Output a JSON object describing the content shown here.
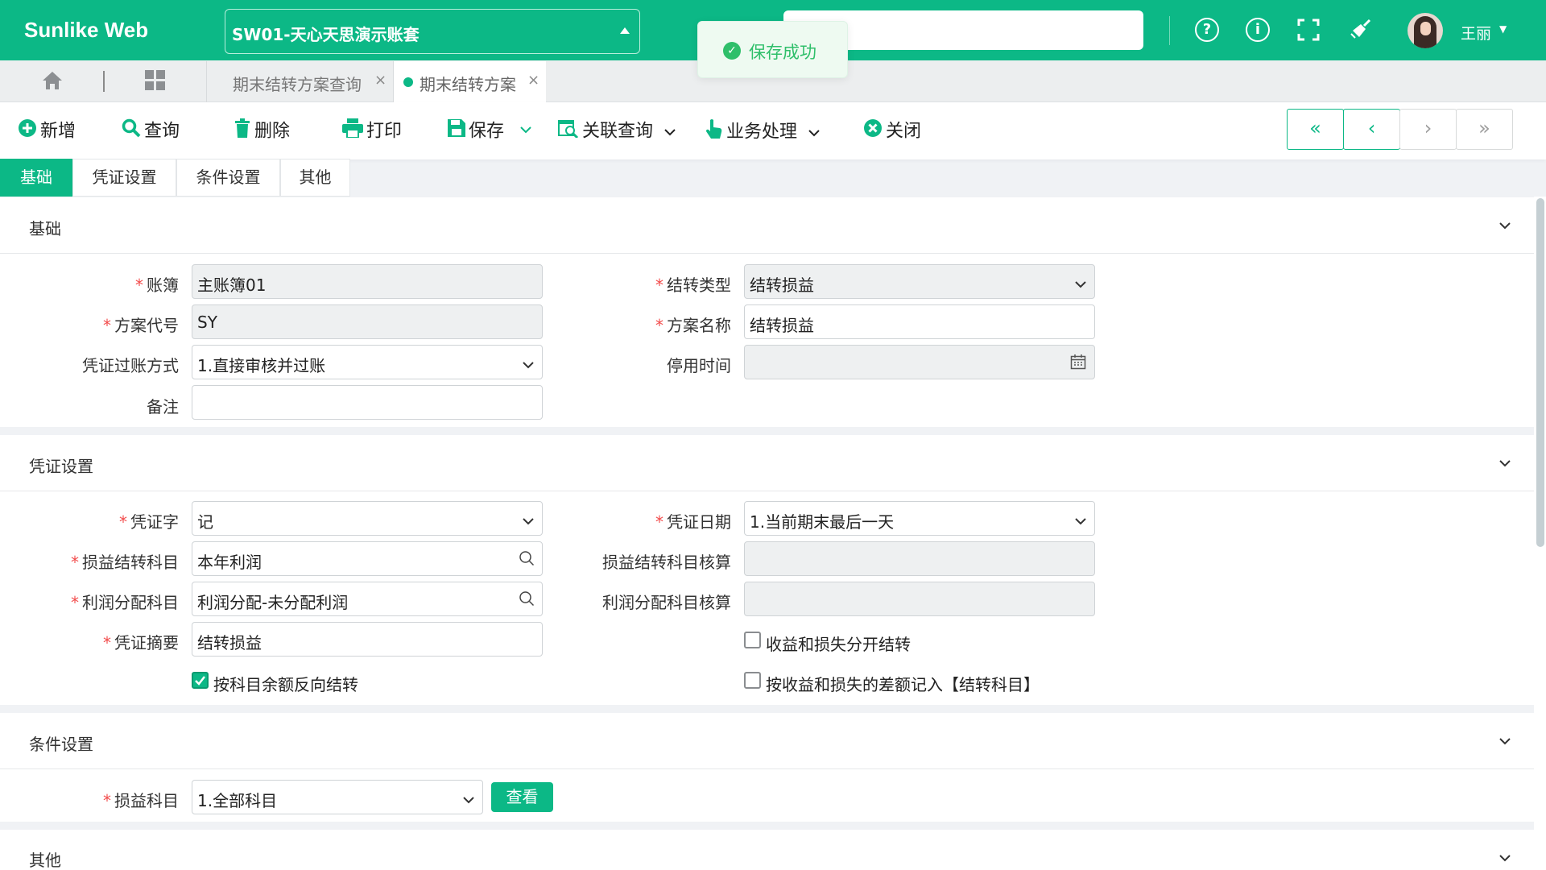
{
  "app": {
    "brand": "Sunlike Web",
    "account": "SW01-天心天思演示账套",
    "user_name": "王丽"
  },
  "toast": {
    "message": "保存成功"
  },
  "tabs": [
    {
      "label": "期末结转方案查询",
      "active": false
    },
    {
      "label": "期末结转方案",
      "active": true
    }
  ],
  "toolbar": {
    "add": "新增",
    "query": "查询",
    "delete": "删除",
    "print": "打印",
    "save": "保存",
    "related_query": "关联查询",
    "business": "业务处理",
    "close": "关闭"
  },
  "subtabs": [
    "基础",
    "凭证设置",
    "条件设置",
    "其他"
  ],
  "sections": {
    "basic": "基础",
    "voucher": "凭证设置",
    "condition": "条件设置",
    "other": "其他"
  },
  "basic": {
    "ledger_label": "账簿",
    "ledger_value": "主账簿01",
    "carry_type_label": "结转类型",
    "carry_type_value": "结转损益",
    "plan_code_label": "方案代号",
    "plan_code_value": "SY",
    "plan_name_label": "方案名称",
    "plan_name_value": "结转损益",
    "posting_label": "凭证过账方式",
    "posting_value": "1.直接审核并过账",
    "disable_time_label": "停用时间",
    "disable_time_value": "",
    "remark_label": "备注",
    "remark_value": ""
  },
  "voucher": {
    "word_label": "凭证字",
    "word_value": "记",
    "date_label": "凭证日期",
    "date_value": "1.当前期末最后一天",
    "pl_account_label": "损益结转科目",
    "pl_account_value": "本年利润",
    "pl_account_check_label": "损益结转科目核算",
    "pl_account_check_value": "",
    "profit_account_label": "利润分配科目",
    "profit_account_value": "利润分配-未分配利润",
    "profit_account_check_label": "利润分配科目核算",
    "profit_account_check_value": "",
    "summary_label": "凭证摘要",
    "summary_value": "结转损益",
    "separate_label": "收益和损失分开结转",
    "separate_checked": false,
    "reverse_label": "按科目余额反向结转",
    "reverse_checked": true,
    "difference_label": "按收益和损失的差额记入【结转科目】",
    "difference_checked": false
  },
  "condition": {
    "pl_subject_label": "损益科目",
    "pl_subject_value": "1.全部科目",
    "view_button": "查看"
  },
  "colors": {
    "accent": "#0cb886",
    "required": "#f24b4b"
  }
}
